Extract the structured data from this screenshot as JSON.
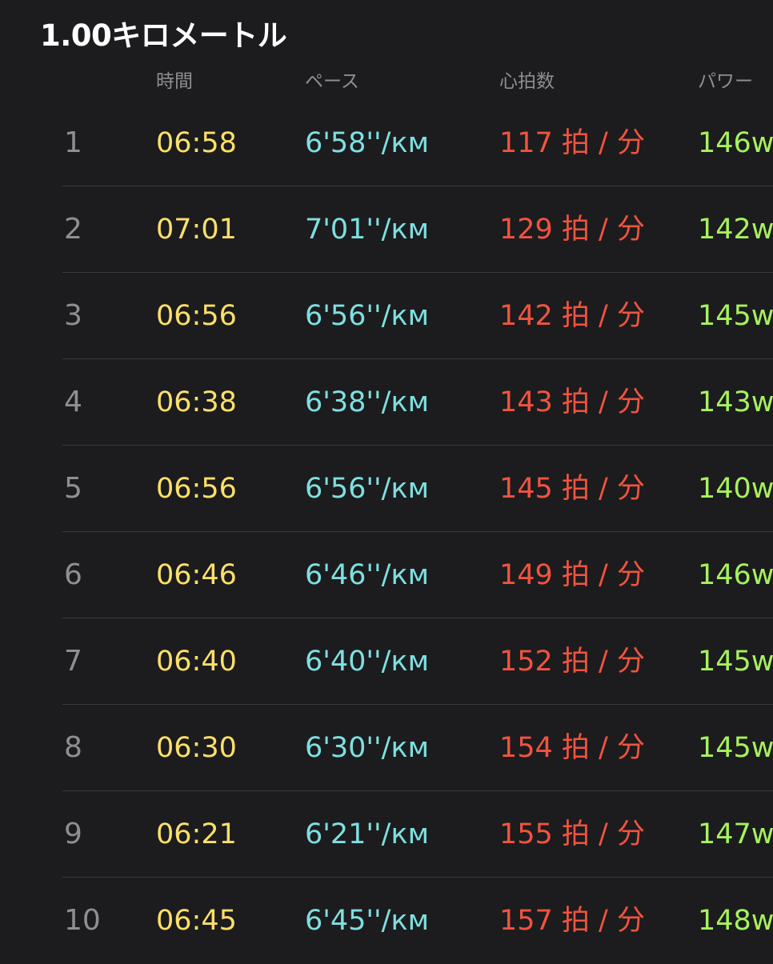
{
  "title": "1.00キロメートル",
  "columns": {
    "time": "時間",
    "pace": "ペース",
    "heart_rate": "心拍数",
    "power": "パワー"
  },
  "rows": [
    {
      "num": "1",
      "time": "06:58",
      "pace": "6'58''/км",
      "hr": "117 拍 / 分",
      "power": "146w"
    },
    {
      "num": "2",
      "time": "07:01",
      "pace": "7'01''/км",
      "hr": "129 拍 / 分",
      "power": "142w"
    },
    {
      "num": "3",
      "time": "06:56",
      "pace": "6'56''/км",
      "hr": "142 拍 / 分",
      "power": "145w"
    },
    {
      "num": "4",
      "time": "06:38",
      "pace": "6'38''/км",
      "hr": "143 拍 / 分",
      "power": "143w"
    },
    {
      "num": "5",
      "time": "06:56",
      "pace": "6'56''/км",
      "hr": "145 拍 / 分",
      "power": "140w"
    },
    {
      "num": "6",
      "time": "06:46",
      "pace": "6'46''/км",
      "hr": "149 拍 / 分",
      "power": "146w"
    },
    {
      "num": "7",
      "time": "06:40",
      "pace": "6'40''/км",
      "hr": "152 拍 / 分",
      "power": "145w"
    },
    {
      "num": "8",
      "time": "06:30",
      "pace": "6'30''/км",
      "hr": "154 拍 / 分",
      "power": "145w"
    },
    {
      "num": "9",
      "time": "06:21",
      "pace": "6'21''/км",
      "hr": "155 拍 / 分",
      "power": "147w"
    },
    {
      "num": "10",
      "time": "06:45",
      "pace": "6'45''/км",
      "hr": "157 拍 / 分",
      "power": "148w"
    }
  ],
  "colors": {
    "background": "#1c1c1e",
    "time": "#fde068",
    "pace": "#7ee0e0",
    "heart_rate": "#f2533f",
    "power": "#a6f25d",
    "secondary": "#8e8e93"
  }
}
